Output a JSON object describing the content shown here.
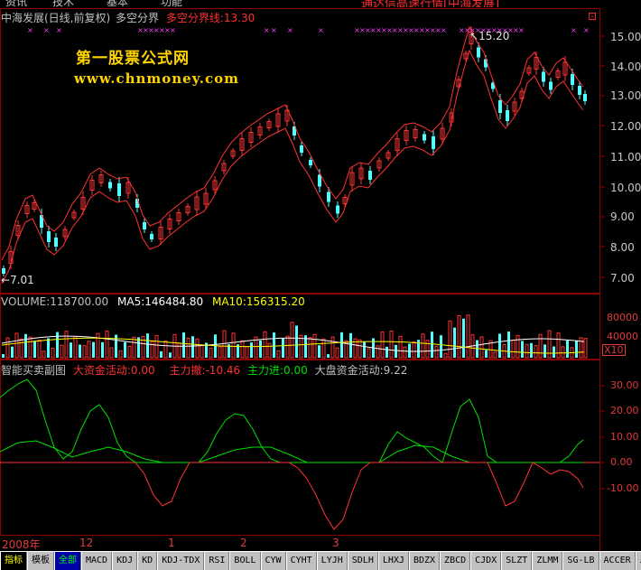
{
  "top_strip": {
    "left_items": [
      "资讯",
      "技术",
      "基本",
      "功能"
    ],
    "right_text": "通达信高速行情[中海发展]"
  },
  "main_panel": {
    "stock": "中海发展(日线,前复权)",
    "indicator": "多空分界",
    "indicator_value": "多空分界线:13.30",
    "high_marker": "15.20",
    "low_marker": "7.01",
    "y_ticks": [
      "15.00",
      "14.00",
      "13.00",
      "12.00",
      "11.00",
      "10.00",
      "9.00",
      "8.00",
      "7.00"
    ],
    "corner_button": "⊡"
  },
  "watermark": {
    "line1": "第一股票公式网",
    "line2": "www.chnmoney.com"
  },
  "volume_panel": {
    "volume": "VOLUME:118700.00",
    "ma5": "MA5:146484.80",
    "ma10": "MA10:156315.20",
    "y_ticks": [
      "80000",
      "40000"
    ],
    "unit": "X10"
  },
  "sub_panel": {
    "name": "智能买卖副图",
    "big_money": "大资金活动:0.00",
    "main_withdraw": "主力撤:-10.46",
    "main_enter": "主力进:0.00",
    "market_money": "大盘资金活动:9.22",
    "y_ticks": [
      "30.00",
      "20.00",
      "10.00",
      "0.00",
      "-10.00"
    ]
  },
  "time_axis": {
    "labels": [
      "2008年",
      "12",
      "1",
      "2",
      "3"
    ]
  },
  "tabs": [
    "指标",
    "模板",
    "全部",
    "MACD",
    "KDJ",
    "KD",
    "KDJ-TDX",
    "RSI",
    "BOLL",
    "CYW",
    "CYHT",
    "LYJH",
    "SDLH",
    "LHXJ",
    "BDZX",
    "ZBCD",
    "CJDX",
    "SLZT",
    "ZLMM",
    "SG-LB",
    "ACCER",
    "JS"
  ],
  "colors": {
    "up": "#ff3232",
    "down": "#54ffff",
    "ma_white": "#ffffff",
    "ma_yellow": "#ffff00",
    "green_line": "#00e000",
    "purple_marker": "#ff40ff",
    "grid": "#8b0000"
  }
}
